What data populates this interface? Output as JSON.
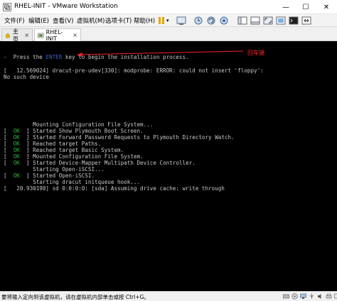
{
  "window": {
    "title": "RHEL-INIT - VMware Workstation",
    "min_glyph": "—",
    "max_glyph": "☐",
    "close_glyph": "✕"
  },
  "menu": {
    "items": [
      "文件(F)",
      "编辑(E)",
      "查看(V)",
      "虚拟机(M)",
      "选项卡(T)",
      "帮助(H)"
    ],
    "dropdown_glyph": "▾"
  },
  "tabs": {
    "home_label": "主页",
    "vm_label": "RHEL-INIT",
    "close_glyph": "×"
  },
  "console": {
    "line_press_a": "-  Press the ",
    "line_press_key": "ENTER",
    "line_press_b": " key to begin the installation process.",
    "line_err1": "[   12.569024] dracut-pre-udev[330]: modprobe: ERROR: could not insert 'floppy':",
    "line_err2": "No such device",
    "line_mount": "         Mounting Configuration File System...",
    "ok_lines": [
      "Started Show Plymouth Boot Screen.",
      "Started Forward Password Requests to Plymouth Directory Watch.",
      "Reached target Paths.",
      "Reached target Basic System.",
      "Mounted Configuration File System.",
      "Started Device-Mapper Multipath Device Controller."
    ],
    "line_starting_iscsi": "         Starting Open-iSCSI...",
    "ok_iscsi": "Started Open-iSCSI.",
    "line_starting_dracut": "         Starting dracut initqueue hook...",
    "line_sd": "[   20.930190] sd 0:0:0:0: [sda] Assuming drive cache: write through",
    "ok_text": "OK",
    "annotation_label": "回车键",
    "colors": {
      "ok": "#2db52d",
      "enter": "#3a5fd0",
      "annotation": "#ff2020"
    }
  },
  "status": {
    "text": "要将输入定向到该虚拟机，请在虚拟机内部单击或按 Ctrl+G。"
  }
}
